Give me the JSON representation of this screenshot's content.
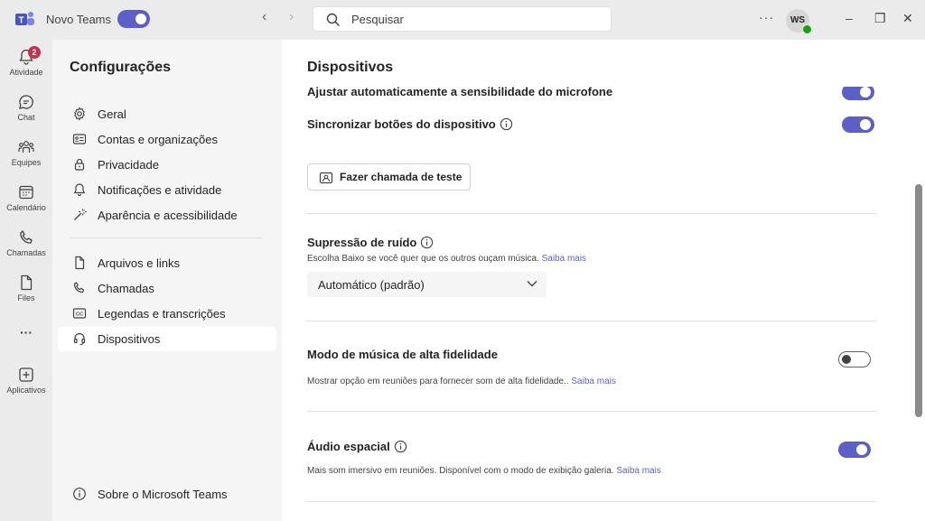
{
  "titlebar": {
    "app_name": "Novo Teams",
    "search_placeholder": "Pesquisar",
    "more_label": "···",
    "avatar_initials": "WS"
  },
  "rail": {
    "items": [
      {
        "label": "Atividade",
        "badge": "2"
      },
      {
        "label": "Chat"
      },
      {
        "label": "Equipes"
      },
      {
        "label": "Calendário"
      },
      {
        "label": "Chamadas"
      },
      {
        "label": "Files"
      },
      {
        "label": "Aplicativos"
      }
    ],
    "more_label": "···"
  },
  "settings_nav": {
    "title": "Configurações",
    "items": [
      {
        "label": "Geral"
      },
      {
        "label": "Contas e organizações"
      },
      {
        "label": "Privacidade"
      },
      {
        "label": "Notificações e atividade"
      },
      {
        "label": "Aparência e acessibilidade"
      },
      {
        "label": "Arquivos e links"
      },
      {
        "label": "Chamadas"
      },
      {
        "label": "Legendas e transcrições"
      },
      {
        "label": "Dispositivos"
      }
    ],
    "about_label": "Sobre o Microsoft Teams"
  },
  "content": {
    "title": "Dispositivos",
    "auto_mic": {
      "label": "Ajustar automaticamente a sensibilidade do microfone",
      "enabled": true
    },
    "sync_buttons": {
      "label": "Sincronizar botões do dispositivo",
      "enabled": true
    },
    "test_call_label": "Fazer chamada de teste",
    "noise": {
      "label": "Supressão de ruído",
      "desc": "Escolha Baixo se você quer que os outros ouçam música.",
      "link": "Saiba mais",
      "selected": "Automático (padrão)"
    },
    "hifi": {
      "label": "Modo de música de alta fidelidade",
      "desc": "Mostrar opção em reuniões para fornecer som de alta fidelidade..",
      "link": "Saiba mais",
      "enabled": false
    },
    "spatial": {
      "label": "Áudio espacial",
      "desc": "Mais som imersivo em reuniões. Disponível com o modo de exibição galeria.",
      "link": "Saiba mais",
      "enabled": true
    }
  },
  "colors": {
    "accent": "#5b5fc7",
    "badge": "#c4314b",
    "presence": "#13a10e"
  }
}
